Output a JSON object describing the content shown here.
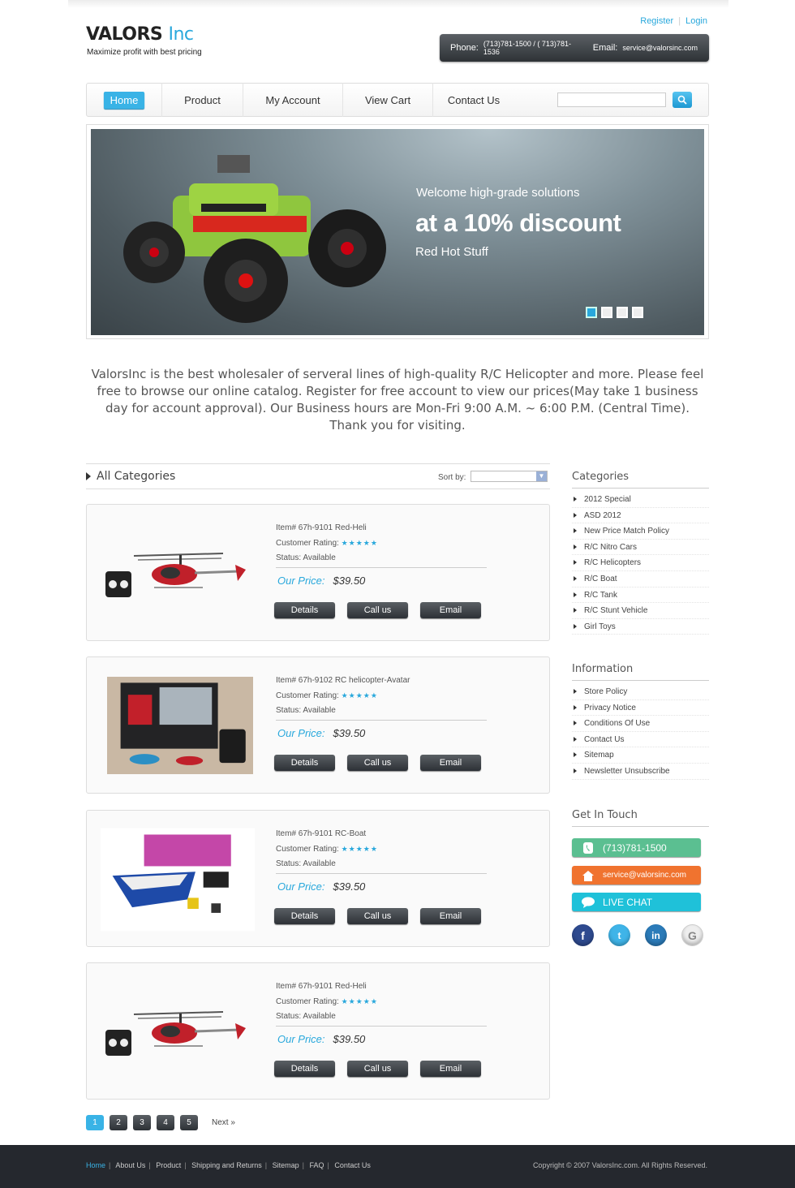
{
  "brand": {
    "name_part1": "VALORS",
    "name_part2": "Inc",
    "tagline": "Maximize profit with best pricing"
  },
  "top_links": {
    "register": "Register",
    "login": "Login"
  },
  "contact_bar": {
    "phone_label": "Phone:",
    "phone_value": "(713)781-1500 / ( 713)781-1536",
    "email_label": "Email:",
    "email_value": "service@valorsinc.com"
  },
  "nav": {
    "items": [
      "Home",
      "Product",
      "My Account",
      "View Cart",
      "Contact Us"
    ],
    "search_placeholder": "",
    "search_icon": "search-icon"
  },
  "banner": {
    "line1": "Welcome high-grade solutions",
    "line2": "at a 10% discount",
    "line3": "Red Hot Stuff",
    "slides": 4,
    "active_slide": 1
  },
  "intro": {
    "text": "ValorsInc is the best wholesaler of serveral lines of high-quality R/C Helicopter and more. Please feel free to browse our online catalog. Register for free account to view our prices(May take 1 business day for account approval). Our Business hours are Mon-Fri 9:00 A.M. ~ 6:00 P.M. (Central Time). Thank you for visiting."
  },
  "catalog": {
    "title": "All Categories",
    "sort_label": "Sort by:",
    "sort_value": ""
  },
  "products": [
    {
      "item": "Item#  67h-9101 Red-Heli",
      "rating_label": "Customer Rating:",
      "stars": "★★★★★",
      "status": "Status: Available",
      "price_label": "Our Price:",
      "price": "$39.50",
      "image": "helicopter"
    },
    {
      "item": "Item#  67h-9102 RC helicopter-Avatar",
      "rating_label": "Customer Rating:",
      "stars": "★★★★★",
      "status": "Status: Available",
      "price_label": "Our Price:",
      "price": "$39.50",
      "image": "boxed-helicopter"
    },
    {
      "item": "Item#  67h-9101 RC-Boat",
      "rating_label": "Customer Rating:",
      "stars": "★★★★★",
      "status": "Status: Available",
      "price_label": "Our Price:",
      "price": "$39.50",
      "image": "boat"
    },
    {
      "item": "Item#  67h-9101 Red-Heli",
      "rating_label": "Customer Rating:",
      "stars": "★★★★★",
      "status": "Status: Available",
      "price_label": "Our Price:",
      "price": "$39.50",
      "image": "helicopter"
    }
  ],
  "product_buttons": {
    "details": "Details",
    "call": "Call us",
    "email": "Email"
  },
  "pager": {
    "pages": [
      "1",
      "2",
      "3",
      "4",
      "5"
    ],
    "current": "1",
    "next": "Next"
  },
  "sidebar": {
    "categories_title": "Categories",
    "categories": [
      "2012 Special",
      "ASD 2012",
      "New Price Match Policy",
      "R/C Nitro Cars",
      "R/C Helicopters",
      "R/C Boat",
      "R/C Tank",
      "R/C Stunt Vehicle",
      "Girl Toys"
    ],
    "information_title": "Information",
    "information": [
      "Store Policy",
      "Privacy Notice",
      "Conditions Of Use",
      "Contact Us",
      "Sitemap",
      "Newsletter Unsubscribe"
    ],
    "touch_title": "Get In Touch",
    "touch_phone": "(713)781-1500",
    "touch_email": "service@valorsinc.com",
    "touch_chat": "LIVE CHAT",
    "social": [
      "facebook-icon",
      "twitter-icon",
      "linkedin-icon",
      "google-icon"
    ]
  },
  "footer": {
    "links": [
      "Home",
      "About Us",
      "Product",
      "Shipping and Returns",
      "Sitemap",
      "FAQ",
      "Contact Us"
    ],
    "copyright": "Copyright © 2007 ValorsInc.com.   All Rights Reserved."
  },
  "colors": {
    "accent": "#29a8dc",
    "dark_button": "#2d3136",
    "phone_green": "#5bbf91",
    "email_orange": "#f0732f",
    "chat_cyan": "#1fc1d9",
    "footer": "#25282e"
  }
}
